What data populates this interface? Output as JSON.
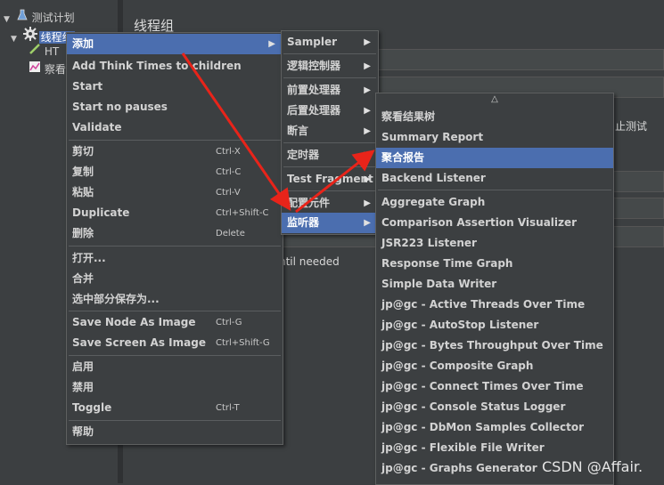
{
  "tree": {
    "items": [
      {
        "label": "测试计划"
      },
      {
        "label": "线程组"
      },
      {
        "label": "HT"
      },
      {
        "label": "察看"
      }
    ]
  },
  "right": {
    "title": "线程组",
    "stop_label": "止测试",
    "until_label": "ntil needed"
  },
  "context_menu": {
    "items": [
      {
        "label": "添加",
        "shortcut": "",
        "submenu": true
      },
      {
        "label": "Add Think Times to children",
        "shortcut": ""
      },
      {
        "label": "Start",
        "shortcut": ""
      },
      {
        "label": "Start no pauses",
        "shortcut": ""
      },
      {
        "label": "Validate",
        "shortcut": ""
      },
      {
        "label": "剪切",
        "shortcut": "Ctrl-X"
      },
      {
        "label": "复制",
        "shortcut": "Ctrl-C"
      },
      {
        "label": "粘贴",
        "shortcut": "Ctrl-V"
      },
      {
        "label": "Duplicate",
        "shortcut": "Ctrl+Shift-C"
      },
      {
        "label": "删除",
        "shortcut": "Delete"
      },
      {
        "label": "打开...",
        "shortcut": ""
      },
      {
        "label": "合并",
        "shortcut": ""
      },
      {
        "label": "选中部分保存为...",
        "shortcut": ""
      },
      {
        "label": "Save Node As Image",
        "shortcut": "Ctrl-G"
      },
      {
        "label": "Save Screen As Image",
        "shortcut": "Ctrl+Shift-G"
      },
      {
        "label": "启用",
        "shortcut": ""
      },
      {
        "label": "禁用",
        "shortcut": ""
      },
      {
        "label": "Toggle",
        "shortcut": "Ctrl-T"
      },
      {
        "label": "帮助",
        "shortcut": ""
      }
    ]
  },
  "add_submenu": {
    "items": [
      {
        "label": "Sampler"
      },
      {
        "label": "逻辑控制器"
      },
      {
        "label": "前置处理器"
      },
      {
        "label": "后置处理器"
      },
      {
        "label": "断言"
      },
      {
        "label": "定时器"
      },
      {
        "label": "Test Fragment"
      },
      {
        "label": "配置元件"
      },
      {
        "label": "监听器"
      }
    ]
  },
  "listener_submenu": {
    "scroll_up": "△",
    "items": [
      {
        "label": "察看结果树"
      },
      {
        "label": "Summary Report"
      },
      {
        "label": "聚合报告"
      },
      {
        "label": "Backend Listener"
      },
      {
        "label": "Aggregate Graph"
      },
      {
        "label": "Comparison Assertion Visualizer"
      },
      {
        "label": "JSR223 Listener"
      },
      {
        "label": "Response Time Graph"
      },
      {
        "label": "Simple Data Writer"
      },
      {
        "label": "jp@gc - Active Threads Over Time"
      },
      {
        "label": "jp@gc - AutoStop Listener"
      },
      {
        "label": "jp@gc - Bytes Throughput Over Time"
      },
      {
        "label": "jp@gc - Composite Graph"
      },
      {
        "label": "jp@gc - Connect Times Over Time"
      },
      {
        "label": "jp@gc - Console Status Logger"
      },
      {
        "label": "jp@gc - DbMon Samples Collector"
      },
      {
        "label": "jp@gc - Flexible File Writer"
      },
      {
        "label": "jp@gc - Graphs Generator"
      }
    ]
  },
  "watermark": "CSDN @Affair.",
  "colors": {
    "background": "#3c3f41",
    "selection": "#4b6eaf",
    "annotation_arrow": "#e8241a"
  }
}
